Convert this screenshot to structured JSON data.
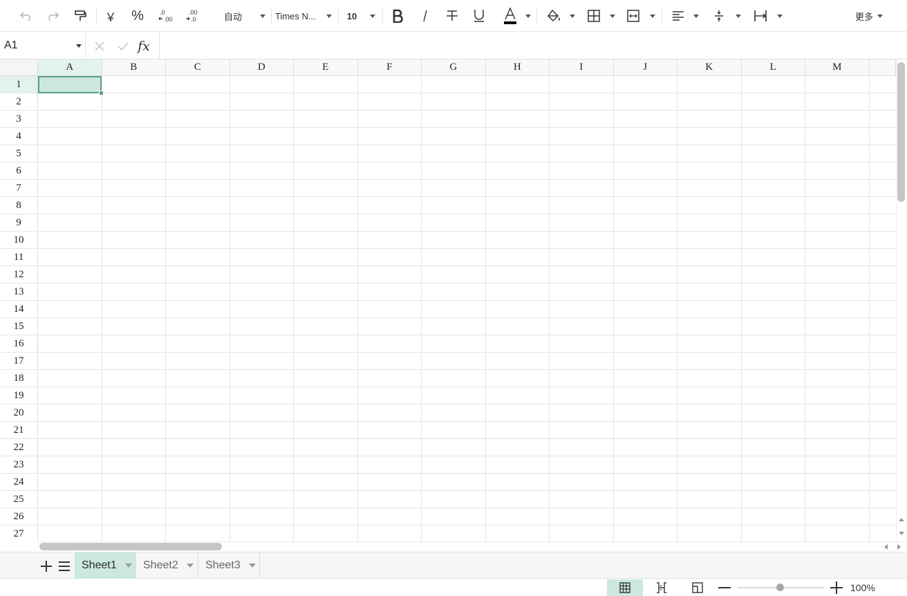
{
  "toolbar": {
    "number_format": "自动",
    "font_name": "Times N...",
    "font_size": "10",
    "currency_symbol": "￥",
    "percent_symbol": "%",
    "more_label": "更多",
    "text_color": "#000000"
  },
  "formula_bar": {
    "cell_ref": "A1",
    "fx_label": "fx",
    "formula_value": ""
  },
  "grid": {
    "columns": [
      "A",
      "B",
      "C",
      "D",
      "E",
      "F",
      "G",
      "H",
      "I",
      "J",
      "K",
      "L",
      "M"
    ],
    "rows": [
      "1",
      "2",
      "3",
      "4",
      "5",
      "6",
      "7",
      "8",
      "9",
      "10",
      "11",
      "12",
      "13",
      "14",
      "15",
      "16",
      "17",
      "18",
      "19",
      "20",
      "21",
      "22",
      "23",
      "24",
      "25",
      "26",
      "27"
    ],
    "active_cell": "A1",
    "selection_color": "#cce8dd",
    "selection_border_color": "#5e9e85"
  },
  "sheets": {
    "tabs": [
      {
        "label": "Sheet1",
        "active": true
      },
      {
        "label": "Sheet2",
        "active": false
      },
      {
        "label": "Sheet3",
        "active": false
      }
    ]
  },
  "status_bar": {
    "zoom": "100%",
    "zoom_fraction": 0.5
  },
  "colors": {
    "accent": "#cde8dd",
    "accent_dark": "#5e9e85"
  }
}
